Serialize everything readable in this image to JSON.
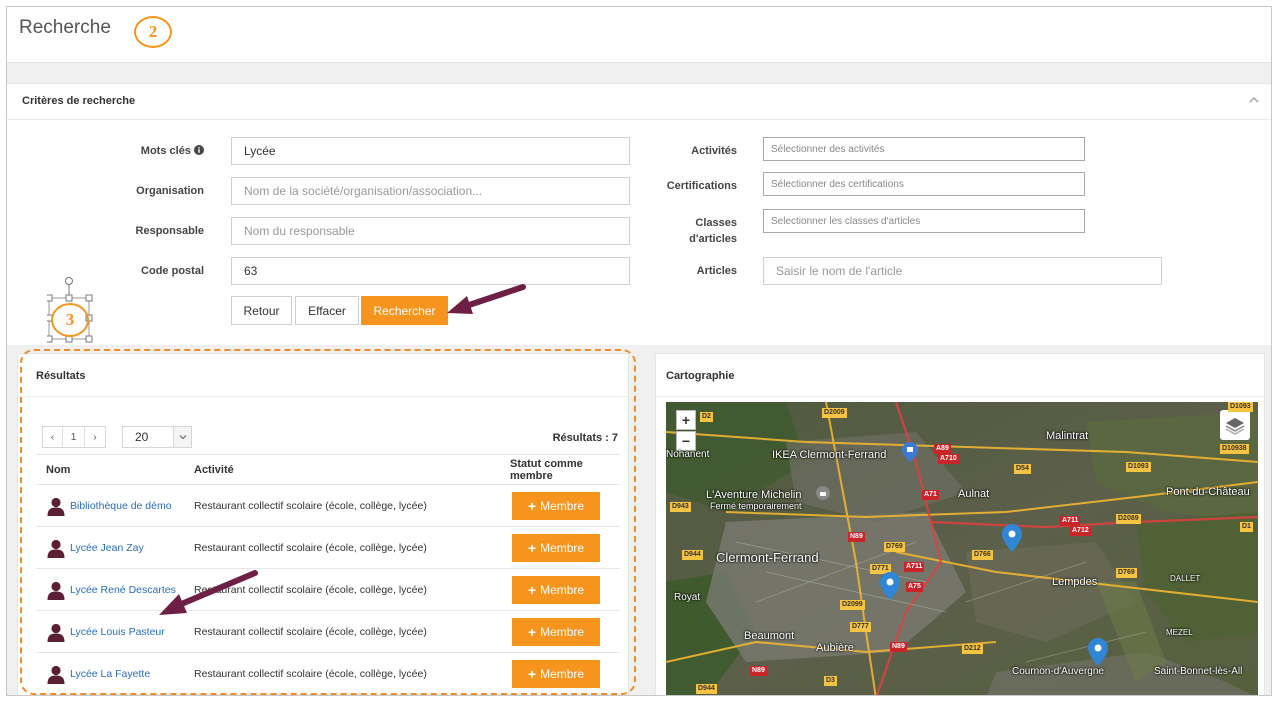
{
  "page": {
    "title": "Recherche"
  },
  "badges": {
    "step2": "2",
    "step3": "3"
  },
  "criteria": {
    "title": "Critères de recherche",
    "keywords": {
      "label": "Mots clés",
      "value": "Lycée"
    },
    "organisation": {
      "label": "Organisation",
      "placeholder": "Nom de la société/organisation/association..."
    },
    "responsable": {
      "label": "Responsable",
      "placeholder": "Nom du responsable"
    },
    "postal": {
      "label": "Code postal",
      "value": "63"
    },
    "activites": {
      "label": "Activités",
      "placeholder": "Sélectionner des activités"
    },
    "certifications": {
      "label": "Certifications",
      "placeholder": "Sélectionner des certifications"
    },
    "classes": {
      "label_line1": "Classes",
      "label_line2": "d'articles",
      "placeholder": "Selectionner les classes d'articles"
    },
    "articles": {
      "label": "Articles",
      "placeholder": "Saisir le nom de l'article"
    },
    "buttons": {
      "back": "Retour",
      "clear": "Effacer",
      "search": "Rechercher"
    }
  },
  "results": {
    "title": "Résultats",
    "pager": {
      "prev": "‹",
      "page": "1",
      "next": "›"
    },
    "page_size": "20",
    "count": "Résultats : 7",
    "columns": {
      "name": "Nom",
      "activity": "Activité",
      "status": "Statut comme membre"
    },
    "member_label": "Membre",
    "rows": [
      {
        "name": "Bibliothèque de démo",
        "activity": "Restaurant collectif scolaire (école, collège, lycée)"
      },
      {
        "name": "Lycée Jean Zay",
        "activity": "Restaurant collectif scolaire (école, collège, lycée)"
      },
      {
        "name": "Lycée René Descartes",
        "activity": "Restaurant collectif scolaire (école, collège, lycée)"
      },
      {
        "name": "Lycée Louis Pasteur",
        "activity": "Restaurant collectif scolaire (école, collège, lycée)"
      },
      {
        "name": "Lycée La Fayette",
        "activity": "Restaurant collectif scolaire (école, collège, lycée)"
      }
    ]
  },
  "map": {
    "title": "Cartographie",
    "zoom_in": "+",
    "zoom_out": "−",
    "places": [
      "Malintrat",
      "IKEA Clermont-Ferrand",
      "L'Aventure Michelin",
      "Fermé temporairement",
      "Aulnat",
      "Pont-du-Château",
      "Clermont-Ferrand",
      "Lempdes",
      "DALLET",
      "Royat",
      "Beaumont",
      "Aubière",
      "MEZEL",
      "Cournon-d'Auvergne",
      "Saint-Bonnet-lès-All",
      "Nohanent"
    ],
    "roads": [
      "D2",
      "D2009",
      "D1093",
      "D10938",
      "A89",
      "A710",
      "D54",
      "D1093",
      "A71",
      "D2089",
      "D1",
      "A711",
      "A712",
      "N89",
      "D769",
      "D766",
      "D943",
      "D944",
      "D771",
      "A711",
      "A75",
      "D769",
      "D2099",
      "D777",
      "N89",
      "D212",
      "D3",
      "D944",
      "N89"
    ]
  },
  "colors": {
    "accent": "#f7941d",
    "link": "#2a6ebb",
    "arrow": "#6e1f45"
  }
}
